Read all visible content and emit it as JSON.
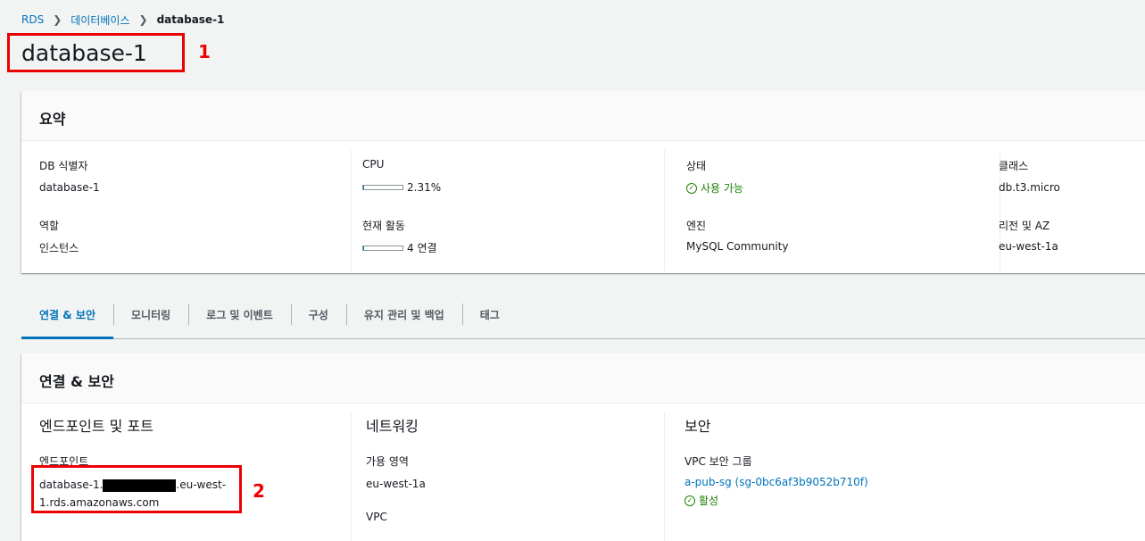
{
  "breadcrumb": {
    "items": [
      "RDS",
      "데이터베이스"
    ],
    "current": "database-1"
  },
  "page": {
    "title": "database-1"
  },
  "annotations": [
    "1",
    "2"
  ],
  "summary": {
    "title": "요약",
    "db_id_label": "DB 식별자",
    "db_id_value": "database-1",
    "cpu_label": "CPU",
    "cpu_value": "2.31%",
    "cpu_fraction": 0.0231,
    "status_label": "상태",
    "status_value": "사용 가능",
    "class_label": "클래스",
    "class_value": "db.t3.micro",
    "role_label": "역할",
    "role_value": "인스턴스",
    "activity_label": "현재 활동",
    "activity_value": "4 연결",
    "activity_fraction": 0.02,
    "engine_label": "엔진",
    "engine_value": "MySQL Community",
    "region_label": "리전 및 AZ",
    "region_value": "eu-west-1a"
  },
  "tabs": [
    "연결 & 보안",
    "모니터링",
    "로그 및 이벤트",
    "구성",
    "유지 관리 및 백업",
    "태그"
  ],
  "connectivity": {
    "title": "연결 & 보안",
    "endpoint_section": "엔드포인트 및 포트",
    "endpoint_label": "엔드포인트",
    "endpoint_prefix": "database-1.",
    "endpoint_suffix": ".eu-west-",
    "endpoint_line2": "1.rds.amazonaws.com",
    "network_section": "네트워킹",
    "az_label": "가용 영역",
    "az_value": "eu-west-1a",
    "vpc_label": "VPC",
    "security_section": "보안",
    "sg_label": "VPC 보안 그룹",
    "sg_value": "a-pub-sg (sg-0bc6af3b9052b710f)",
    "sg_status": "활성"
  },
  "colors": {
    "accent": "#0073bb",
    "success": "#1d8102",
    "annotation": "#ee0000"
  },
  "icons": {
    "breadcrumb_separator": "chevron-right-icon",
    "status": "check-circle-icon"
  }
}
